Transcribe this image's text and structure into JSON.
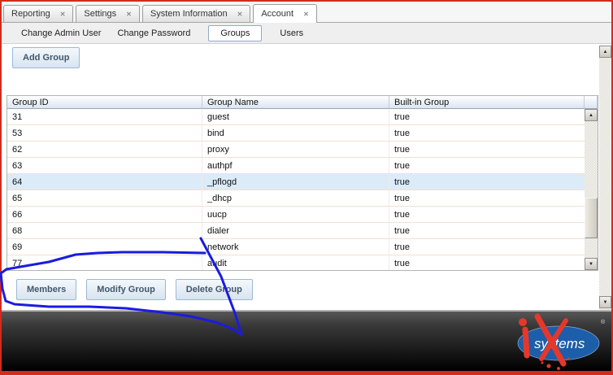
{
  "colors": {
    "frame_red": "#d32b1e",
    "annotation_blue": "#1b1be0",
    "selected_row_bg": "#dcebf8",
    "logo_blue": "#1c5ea9",
    "logo_red": "#e6372b"
  },
  "icons": {
    "close": "✕",
    "scroll_up": "▲",
    "scroll_down": "▼"
  },
  "tabs": [
    {
      "label": "Reporting"
    },
    {
      "label": "Settings"
    },
    {
      "label": "System Information"
    },
    {
      "label": "Account"
    }
  ],
  "subtabs": [
    {
      "label": "Change Admin User"
    },
    {
      "label": "Change Password"
    },
    {
      "label": "Groups"
    },
    {
      "label": "Users"
    }
  ],
  "toolbar": {
    "add_group": "Add Group"
  },
  "table": {
    "columns": [
      "Group ID",
      "Group Name",
      "Built-in Group"
    ],
    "rows": [
      {
        "id": "31",
        "name": "guest",
        "builtin": "true"
      },
      {
        "id": "53",
        "name": "bind",
        "builtin": "true"
      },
      {
        "id": "62",
        "name": "proxy",
        "builtin": "true"
      },
      {
        "id": "63",
        "name": "authpf",
        "builtin": "true"
      },
      {
        "id": "64",
        "name": "_pflogd",
        "builtin": "true"
      },
      {
        "id": "65",
        "name": "_dhcp",
        "builtin": "true"
      },
      {
        "id": "66",
        "name": "uucp",
        "builtin": "true"
      },
      {
        "id": "68",
        "name": "dialer",
        "builtin": "true"
      },
      {
        "id": "69",
        "name": "network",
        "builtin": "true"
      },
      {
        "id": "77",
        "name": "audit",
        "builtin": "true"
      }
    ]
  },
  "actions": [
    {
      "label": "Members"
    },
    {
      "label": "Modify Group"
    },
    {
      "label": "Delete Group"
    }
  ],
  "footer": {
    "brand": "systems",
    "registered": "®"
  }
}
